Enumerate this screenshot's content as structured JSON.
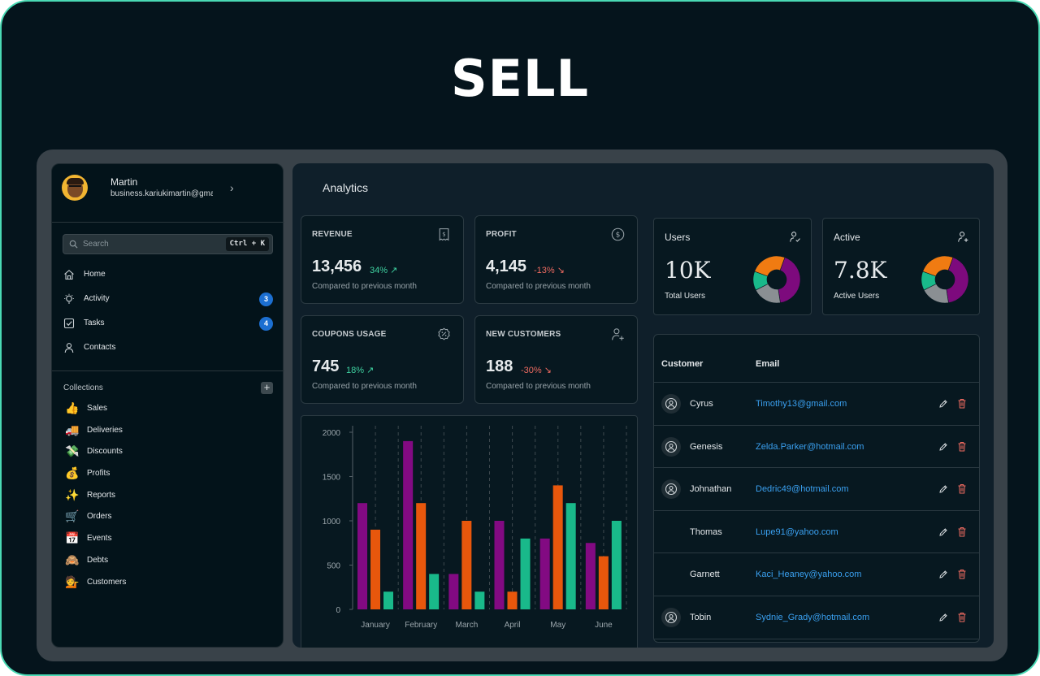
{
  "brand": {
    "logo": "SELL"
  },
  "user": {
    "name": "Martin",
    "email": "business.kariukimartin@gmail.com"
  },
  "search": {
    "placeholder": "Search",
    "shortcut": "Ctrl + K"
  },
  "nav": [
    {
      "label": "Home",
      "icon": "home-icon",
      "badge": null
    },
    {
      "label": "Activity",
      "icon": "bulb-icon",
      "badge": "3"
    },
    {
      "label": "Tasks",
      "icon": "checkbox-icon",
      "badge": "4"
    },
    {
      "label": "Contacts",
      "icon": "person-icon",
      "badge": null
    }
  ],
  "collections": {
    "title": "Collections",
    "add_label": "+",
    "items": [
      {
        "label": "Sales",
        "emoji": "👍"
      },
      {
        "label": "Deliveries",
        "emoji": "🚚"
      },
      {
        "label": "Discounts",
        "emoji": "💸"
      },
      {
        "label": "Profits",
        "emoji": "💰"
      },
      {
        "label": "Reports",
        "emoji": "✨"
      },
      {
        "label": "Orders",
        "emoji": "🛒"
      },
      {
        "label": "Events",
        "emoji": "📅"
      },
      {
        "label": "Debts",
        "emoji": "🙈"
      },
      {
        "label": "Customers",
        "emoji": "💁"
      }
    ]
  },
  "main": {
    "title": "Analytics"
  },
  "stats": [
    {
      "title": "REVENUE",
      "value": "13,456",
      "change": "34%",
      "trend": "up",
      "sub": "Compared to previous month",
      "icon": "receipt-icon"
    },
    {
      "title": "PROFIT",
      "value": "4,145",
      "change": "-13%",
      "trend": "down",
      "sub": "Compared to previous month",
      "icon": "dollar-circle-icon"
    },
    {
      "title": "COUPONS USAGE",
      "value": "745",
      "change": "18%",
      "trend": "up",
      "sub": "Compared to previous month",
      "icon": "discount-badge-icon"
    },
    {
      "title": "NEW CUSTOMERS",
      "value": "188",
      "change": "-30%",
      "trend": "down",
      "sub": "Compared to previous month",
      "icon": "add-user-icon"
    }
  ],
  "user_cards": [
    {
      "title": "Users",
      "value": "10K",
      "sub": "Total Users",
      "icon": "user-check-icon"
    },
    {
      "title": "Active",
      "value": "7.8K",
      "sub": "Active Users",
      "icon": "user-plus-icon"
    }
  ],
  "donut": {
    "segments": [
      {
        "value": 0.42,
        "color": "#7d0a7d"
      },
      {
        "value": 0.2,
        "color": "#8a8f93"
      },
      {
        "value": 0.13,
        "color": "#19b98a"
      },
      {
        "value": 0.25,
        "color": "#f07b12"
      }
    ]
  },
  "chart_data": {
    "type": "bar",
    "categories": [
      "January",
      "February",
      "March",
      "April",
      "May",
      "June"
    ],
    "series": [
      {
        "color": "#820a82",
        "values": [
          1200,
          1900,
          400,
          1000,
          800,
          750
        ]
      },
      {
        "color": "#e8570c",
        "values": [
          900,
          1200,
          1000,
          200,
          1400,
          600
        ]
      },
      {
        "color": "#19b98a",
        "values": [
          200,
          400,
          200,
          800,
          1200,
          1000
        ]
      }
    ],
    "yticks": [
      "0",
      "500",
      "1000",
      "1500",
      "2000"
    ],
    "ylim": [
      0,
      2000
    ]
  },
  "customers": {
    "headers": {
      "customer": "Customer",
      "email": "Email"
    },
    "rows": [
      {
        "name": "Cyrus",
        "email": "Timothy13@gmail.com",
        "avatar": true
      },
      {
        "name": "Genesis",
        "email": "Zelda.Parker@hotmail.com",
        "avatar": true
      },
      {
        "name": "Johnathan",
        "email": "Dedric49@hotmail.com",
        "avatar": true
      },
      {
        "name": "Thomas",
        "email": "Lupe91@yahoo.com",
        "avatar": false
      },
      {
        "name": "Garnett",
        "email": "Kaci_Heaney@yahoo.com",
        "avatar": false
      },
      {
        "name": "Tobin",
        "email": "Sydnie_Grady@hotmail.com",
        "avatar": true
      }
    ]
  }
}
